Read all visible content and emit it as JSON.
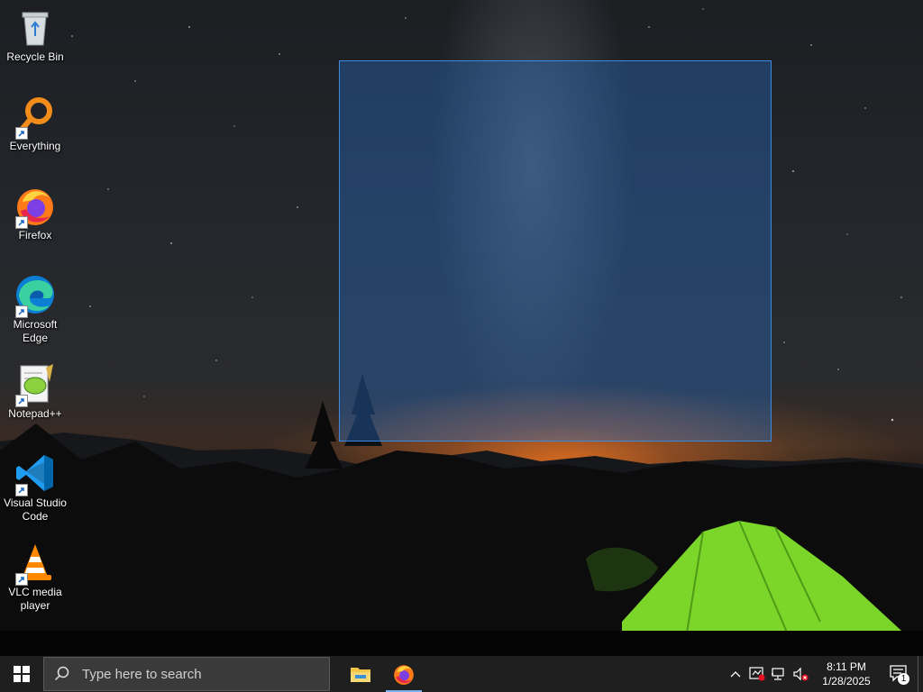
{
  "desktop": {
    "icons": [
      {
        "label": "Recycle Bin",
        "icon": "recycle-bin-icon"
      },
      {
        "label": "Everything",
        "icon": "everything-search-icon"
      },
      {
        "label": "Firefox",
        "icon": "firefox-icon"
      },
      {
        "label": "Microsoft Edge",
        "icon": "edge-icon"
      },
      {
        "label": "Notepad++",
        "icon": "notepad-plus-plus-icon"
      },
      {
        "label": "Visual Studio Code",
        "icon": "vscode-icon"
      },
      {
        "label": "VLC media player",
        "icon": "vlc-icon"
      }
    ]
  },
  "taskbar": {
    "search_placeholder": "Type here to search",
    "apps": [
      {
        "name": "File Explorer",
        "icon": "file-explorer-icon",
        "active": false
      },
      {
        "name": "Firefox",
        "icon": "firefox-icon",
        "active": true
      }
    ],
    "clock": {
      "time": "8:11 PM",
      "date": "1/28/2025"
    },
    "notification_count": "1"
  },
  "colors": {
    "selection_border": "#3a8be0",
    "taskbar_bg": "#1f1f1f",
    "tent_green": "#7cd62a"
  }
}
